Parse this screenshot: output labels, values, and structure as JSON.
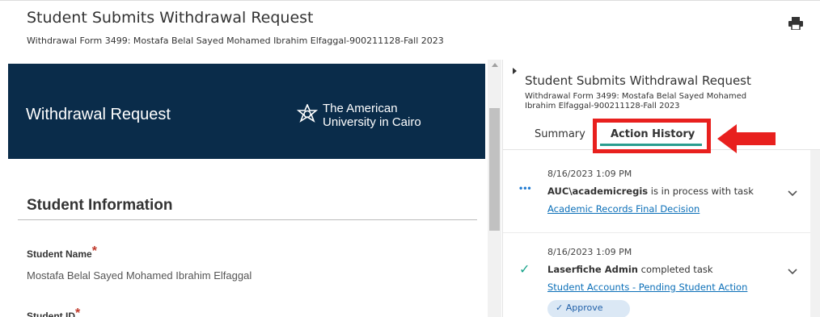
{
  "header": {
    "title": "Student Submits Withdrawal Request",
    "subtitle": "Withdrawal Form 3499: Mostafa Belal Sayed Mohamed Ibrahim Elfaggal-900211128-Fall 2023",
    "print_icon": "printer-icon"
  },
  "form": {
    "banner_title": "Withdrawal Request",
    "logo_line1": "The American",
    "logo_line2": "University in Cairo",
    "banner_color": "#0a2c4a",
    "section_title": "Student Information",
    "student_name_label": "Student Name",
    "student_name_value": "Mostafa Belal Sayed Mohamed Ibrahim Elfaggal",
    "student_id_label": "Student ID",
    "required_mark": "*"
  },
  "side_panel": {
    "title": "Student Submits Withdrawal Request",
    "subtitle_line1": "Withdrawal Form 3499: Mostafa Belal Sayed Mohamed",
    "subtitle_line2": "Ibrahim Elfaggal-900211128-Fall 2023",
    "tabs": [
      {
        "label": "Summary",
        "active": false
      },
      {
        "label": "Action History",
        "active": true
      }
    ],
    "accent_color": "#2a9d8f",
    "annotation_color": "#e8201e",
    "history": [
      {
        "date": "8/16/2023 1:09 PM",
        "actor": "AUC\\academicregis",
        "action_text": " is in process with task",
        "task_link": "Academic Records Final Decision",
        "status_icon": "in-progress-dots-icon"
      },
      {
        "date": "8/16/2023 1:09 PM",
        "actor": "Laserfiche Admin",
        "action_text": " completed task",
        "task_link": "Student Accounts - Pending Student Action",
        "status_icon": "checkmark-icon",
        "badge": "Approve"
      }
    ]
  }
}
